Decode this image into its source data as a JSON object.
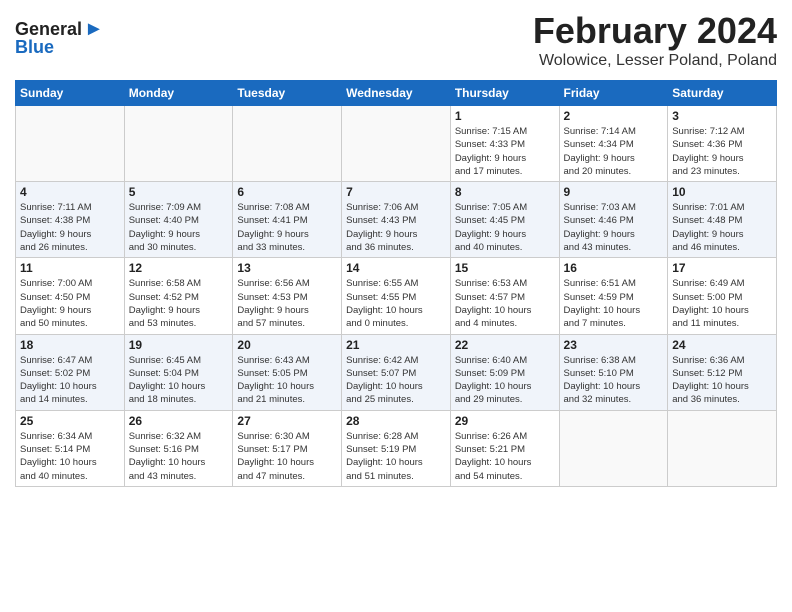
{
  "header": {
    "title": "February 2024",
    "subtitle": "Wolowice, Lesser Poland, Poland",
    "logo_line1": "General",
    "logo_line2": "Blue"
  },
  "days_of_week": [
    "Sunday",
    "Monday",
    "Tuesday",
    "Wednesday",
    "Thursday",
    "Friday",
    "Saturday"
  ],
  "weeks": [
    {
      "row_class": "row-odd",
      "days": [
        {
          "num": "",
          "info": "",
          "empty": true
        },
        {
          "num": "",
          "info": "",
          "empty": true
        },
        {
          "num": "",
          "info": "",
          "empty": true
        },
        {
          "num": "",
          "info": "",
          "empty": true
        },
        {
          "num": "1",
          "info": "Sunrise: 7:15 AM\nSunset: 4:33 PM\nDaylight: 9 hours\nand 17 minutes.",
          "empty": false
        },
        {
          "num": "2",
          "info": "Sunrise: 7:14 AM\nSunset: 4:34 PM\nDaylight: 9 hours\nand 20 minutes.",
          "empty": false
        },
        {
          "num": "3",
          "info": "Sunrise: 7:12 AM\nSunset: 4:36 PM\nDaylight: 9 hours\nand 23 minutes.",
          "empty": false
        }
      ]
    },
    {
      "row_class": "row-even",
      "days": [
        {
          "num": "4",
          "info": "Sunrise: 7:11 AM\nSunset: 4:38 PM\nDaylight: 9 hours\nand 26 minutes.",
          "empty": false
        },
        {
          "num": "5",
          "info": "Sunrise: 7:09 AM\nSunset: 4:40 PM\nDaylight: 9 hours\nand 30 minutes.",
          "empty": false
        },
        {
          "num": "6",
          "info": "Sunrise: 7:08 AM\nSunset: 4:41 PM\nDaylight: 9 hours\nand 33 minutes.",
          "empty": false
        },
        {
          "num": "7",
          "info": "Sunrise: 7:06 AM\nSunset: 4:43 PM\nDaylight: 9 hours\nand 36 minutes.",
          "empty": false
        },
        {
          "num": "8",
          "info": "Sunrise: 7:05 AM\nSunset: 4:45 PM\nDaylight: 9 hours\nand 40 minutes.",
          "empty": false
        },
        {
          "num": "9",
          "info": "Sunrise: 7:03 AM\nSunset: 4:46 PM\nDaylight: 9 hours\nand 43 minutes.",
          "empty": false
        },
        {
          "num": "10",
          "info": "Sunrise: 7:01 AM\nSunset: 4:48 PM\nDaylight: 9 hours\nand 46 minutes.",
          "empty": false
        }
      ]
    },
    {
      "row_class": "row-odd",
      "days": [
        {
          "num": "11",
          "info": "Sunrise: 7:00 AM\nSunset: 4:50 PM\nDaylight: 9 hours\nand 50 minutes.",
          "empty": false
        },
        {
          "num": "12",
          "info": "Sunrise: 6:58 AM\nSunset: 4:52 PM\nDaylight: 9 hours\nand 53 minutes.",
          "empty": false
        },
        {
          "num": "13",
          "info": "Sunrise: 6:56 AM\nSunset: 4:53 PM\nDaylight: 9 hours\nand 57 minutes.",
          "empty": false
        },
        {
          "num": "14",
          "info": "Sunrise: 6:55 AM\nSunset: 4:55 PM\nDaylight: 10 hours\nand 0 minutes.",
          "empty": false
        },
        {
          "num": "15",
          "info": "Sunrise: 6:53 AM\nSunset: 4:57 PM\nDaylight: 10 hours\nand 4 minutes.",
          "empty": false
        },
        {
          "num": "16",
          "info": "Sunrise: 6:51 AM\nSunset: 4:59 PM\nDaylight: 10 hours\nand 7 minutes.",
          "empty": false
        },
        {
          "num": "17",
          "info": "Sunrise: 6:49 AM\nSunset: 5:00 PM\nDaylight: 10 hours\nand 11 minutes.",
          "empty": false
        }
      ]
    },
    {
      "row_class": "row-even",
      "days": [
        {
          "num": "18",
          "info": "Sunrise: 6:47 AM\nSunset: 5:02 PM\nDaylight: 10 hours\nand 14 minutes.",
          "empty": false
        },
        {
          "num": "19",
          "info": "Sunrise: 6:45 AM\nSunset: 5:04 PM\nDaylight: 10 hours\nand 18 minutes.",
          "empty": false
        },
        {
          "num": "20",
          "info": "Sunrise: 6:43 AM\nSunset: 5:05 PM\nDaylight: 10 hours\nand 21 minutes.",
          "empty": false
        },
        {
          "num": "21",
          "info": "Sunrise: 6:42 AM\nSunset: 5:07 PM\nDaylight: 10 hours\nand 25 minutes.",
          "empty": false
        },
        {
          "num": "22",
          "info": "Sunrise: 6:40 AM\nSunset: 5:09 PM\nDaylight: 10 hours\nand 29 minutes.",
          "empty": false
        },
        {
          "num": "23",
          "info": "Sunrise: 6:38 AM\nSunset: 5:10 PM\nDaylight: 10 hours\nand 32 minutes.",
          "empty": false
        },
        {
          "num": "24",
          "info": "Sunrise: 6:36 AM\nSunset: 5:12 PM\nDaylight: 10 hours\nand 36 minutes.",
          "empty": false
        }
      ]
    },
    {
      "row_class": "row-odd",
      "days": [
        {
          "num": "25",
          "info": "Sunrise: 6:34 AM\nSunset: 5:14 PM\nDaylight: 10 hours\nand 40 minutes.",
          "empty": false
        },
        {
          "num": "26",
          "info": "Sunrise: 6:32 AM\nSunset: 5:16 PM\nDaylight: 10 hours\nand 43 minutes.",
          "empty": false
        },
        {
          "num": "27",
          "info": "Sunrise: 6:30 AM\nSunset: 5:17 PM\nDaylight: 10 hours\nand 47 minutes.",
          "empty": false
        },
        {
          "num": "28",
          "info": "Sunrise: 6:28 AM\nSunset: 5:19 PM\nDaylight: 10 hours\nand 51 minutes.",
          "empty": false
        },
        {
          "num": "29",
          "info": "Sunrise: 6:26 AM\nSunset: 5:21 PM\nDaylight: 10 hours\nand 54 minutes.",
          "empty": false
        },
        {
          "num": "",
          "info": "",
          "empty": true
        },
        {
          "num": "",
          "info": "",
          "empty": true
        }
      ]
    }
  ]
}
